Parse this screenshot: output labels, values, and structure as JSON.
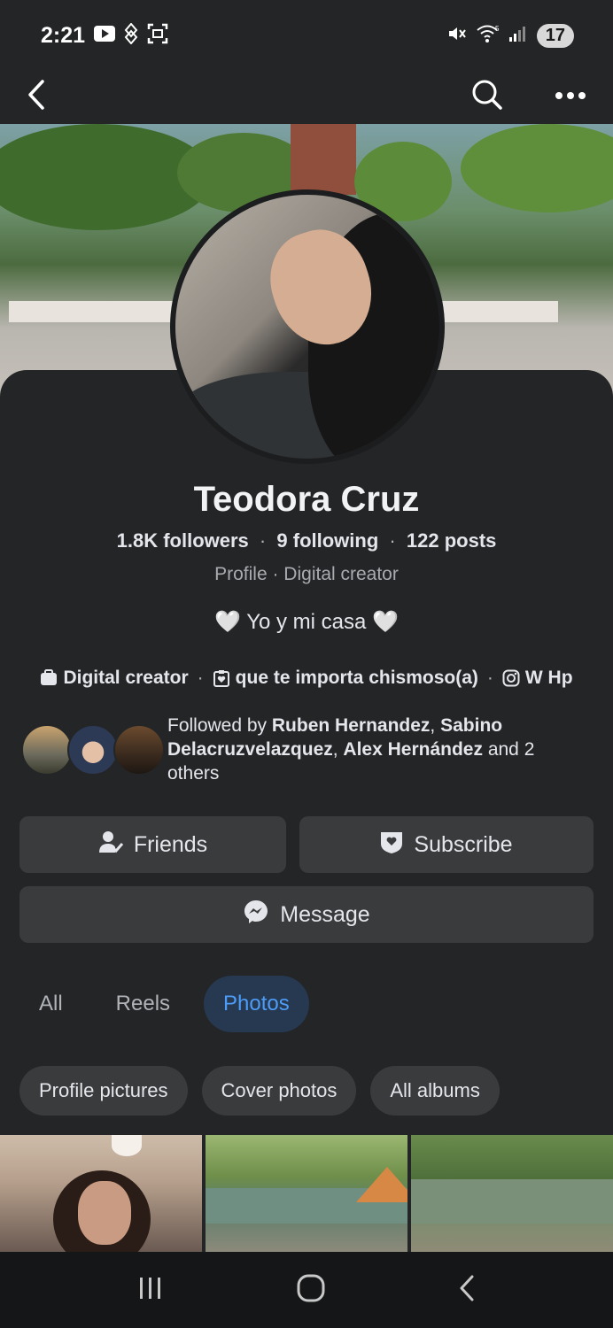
{
  "status_bar": {
    "time": "2:21",
    "battery": "17",
    "network": "5"
  },
  "profile": {
    "name": "Teodora Cruz",
    "followers": "1.8K",
    "followers_label": "followers",
    "following": "9",
    "following_label": "following",
    "posts": "122",
    "posts_label": "posts",
    "subtitle": "Profile · Digital creator",
    "bio": "🤍 Yo y mi casa 🤍",
    "info": {
      "category": "Digital creator",
      "relationship": "que te importa chismoso(a)",
      "instagram": "W Hp"
    },
    "followed_by": {
      "prefix": "Followed by ",
      "name1": "Ruben Hernandez",
      "sep1": ", ",
      "name2": "Sabino Delacruzvelazquez",
      "sep2": ", ",
      "name3": "Alex Hernández",
      "suffix": " and 2 others"
    }
  },
  "buttons": {
    "friends": "Friends",
    "subscribe": "Subscribe",
    "message": "Message"
  },
  "tabs": [
    {
      "label": "All",
      "active": false
    },
    {
      "label": "Reels",
      "active": false
    },
    {
      "label": "Photos",
      "active": true
    }
  ],
  "chips": [
    "Profile pictures",
    "Cover photos",
    "All albums"
  ],
  "colors": {
    "background": "#242526",
    "button": "#3a3b3c",
    "accent": "#4d9cf7",
    "active_tab_bg": "#263951"
  }
}
